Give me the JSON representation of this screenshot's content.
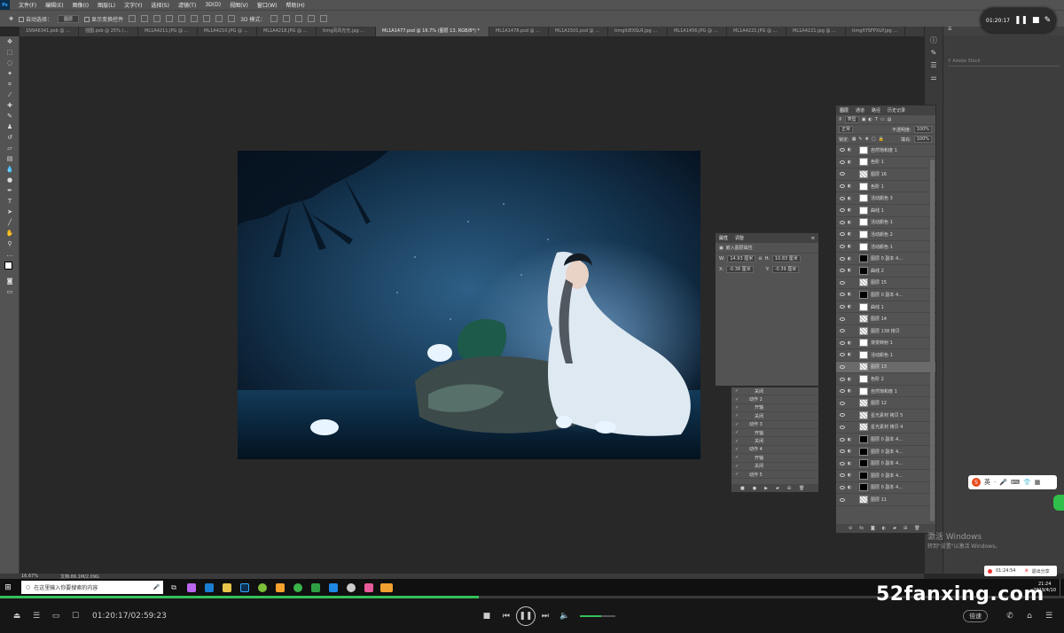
{
  "app": {
    "badge": "Ps"
  },
  "menu": [
    "文件(F)",
    "编辑(E)",
    "图像(I)",
    "图层(L)",
    "文字(Y)",
    "选择(S)",
    "滤镜(T)",
    "3D(D)",
    "视图(V)",
    "窗口(W)",
    "帮助(H)"
  ],
  "options": {
    "auto_select": "自动选择：",
    "auto_select_value": "图层",
    "show_transform": "显示变换控件",
    "mode3d": "3D 模式："
  },
  "tabs": [
    "1N9A6341.psb @ ...",
    "插图.psb @ 25% (...",
    "ML1A4211.JPG @ ...",
    "ML1A4210.JPG @ ...",
    "ML1A4218.JPG @ ...",
    "timg风风光光.jpg ...",
    "ML1A1477.psd @ 16.7% (图层 13, RGB/8*) *",
    "ML1A1478.psd @ ...",
    "ML1A1501.psd @ ...",
    "timgIUEXSLR.jpg ...",
    "ML1A1456.JPG @ ...",
    "ML1A4221.JPG @ ...",
    "ML1A4221.jpg @ ...",
    "timgXYSFPXLP.jpg ..."
  ],
  "status": {
    "zoom": "16.67%",
    "doc": "文档:86.1M/2.09G"
  },
  "properties": {
    "tabs": [
      "属性",
      "调整"
    ],
    "title": "嵌入图层属性",
    "w_label": "W:",
    "w": "14.93 厘米",
    "h_label": "H:",
    "h": "10.83 厘米",
    "x_label": "X:",
    "x": "-0.38 厘米",
    "y_label": "Y:",
    "y": "-0.39 厘米"
  },
  "actions": {
    "rows": [
      [
        "✓",
        "关闭"
      ],
      [
        "✓",
        "动作 2"
      ],
      [
        "✓",
        "开轴"
      ],
      [
        "✓",
        "关闭"
      ],
      [
        "✓",
        "动作 3"
      ],
      [
        "✓",
        "开轴"
      ],
      [
        "✓",
        "关闭"
      ],
      [
        "✓",
        "动作 4"
      ],
      [
        "✓",
        "开轴"
      ],
      [
        "✓",
        "关闭"
      ],
      [
        "✓",
        "动作 5"
      ]
    ]
  },
  "layers": {
    "tabs": [
      "图层",
      "通道",
      "路径",
      "历史记录"
    ],
    "filter": "类型",
    "blend": "正常",
    "opacity_label": "不透明度:",
    "opacity": "100%",
    "lock_label": "锁定:",
    "fill_label": "填充:",
    "fill": "100%",
    "rows": [
      {
        "name": "自然饱和度 1",
        "t": "w"
      },
      {
        "name": "色阶 1",
        "t": "w"
      },
      {
        "name": "图层 16",
        "t": "c"
      },
      {
        "name": "色阶 1",
        "t": "w"
      },
      {
        "name": "活动颜色 3",
        "t": "w"
      },
      {
        "name": "曲线 1",
        "t": "w"
      },
      {
        "name": "活动颜色 1",
        "t": "w"
      },
      {
        "name": "活动颜色 2",
        "t": "w"
      },
      {
        "name": "活动颜色 1",
        "t": "w"
      },
      {
        "name": "图层 0 副本 4...",
        "t": "d"
      },
      {
        "name": "曲线 2",
        "t": "d"
      },
      {
        "name": "图层 15",
        "t": "c"
      },
      {
        "name": "图层 0 副本 4...",
        "t": "d"
      },
      {
        "name": "曲线 1",
        "t": "w"
      },
      {
        "name": "图层 14",
        "t": "c"
      },
      {
        "name": "图层 138 拷贝",
        "t": "c"
      },
      {
        "name": "渐变映射 1",
        "t": "w"
      },
      {
        "name": "活动颜色 1",
        "t": "w"
      },
      {
        "name": "图层 13",
        "t": "c",
        "sel": true
      },
      {
        "name": "色阶 2",
        "t": "w"
      },
      {
        "name": "自然饱和度 1",
        "t": "w"
      },
      {
        "name": "图层 12",
        "t": "c"
      },
      {
        "name": "星光素材 拷贝 5",
        "t": "c"
      },
      {
        "name": "星光素材 拷贝 4",
        "t": "c"
      },
      {
        "name": "图层 0 副本 4...",
        "t": "d"
      },
      {
        "name": "图层 0 副本 4...",
        "t": "d"
      },
      {
        "name": "图层 0 副本 4...",
        "t": "d"
      },
      {
        "name": "图层 0 副本 4...",
        "t": "d"
      },
      {
        "name": "图层 0 副本 4...",
        "t": "d"
      },
      {
        "name": "图层 11",
        "t": "c"
      }
    ]
  },
  "right": {
    "search": "Adobe Stock"
  },
  "timer": "01:20:17",
  "watermark": {
    "line1": "激活 Windows",
    "line2": "转到\"设置\"以激活 Windows。"
  },
  "ime": "英",
  "rec": {
    "time": "01:24:54",
    "exit": "退出分享"
  },
  "taskbar": {
    "search": "在这里输入你要搜索的内容",
    "time": "21:24",
    "date": "2019/4/10"
  },
  "player": {
    "time": "01:20:17/02:59:23",
    "rate": "倍速",
    "progress": 0.45,
    "volume": 0.6
  },
  "brand": "52fanxing.com"
}
